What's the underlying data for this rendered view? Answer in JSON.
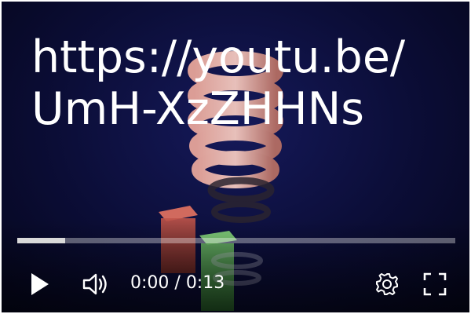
{
  "overlay": {
    "url_line1": "https://youtu.be/",
    "url_line2": "UmH-XzZHHNs"
  },
  "player": {
    "current_time": "0:00",
    "separator": " / ",
    "duration": "0:13",
    "progress_fraction": 0.11,
    "icons": {
      "play": "play-icon",
      "volume": "volume-icon",
      "settings": "gear-icon",
      "fullscreen": "fullscreen-icon"
    }
  },
  "colors": {
    "background": "#0b0d36",
    "text": "#ffffff",
    "progress_track": "#8a8a9a",
    "progress_fill": "#d9d9d9"
  }
}
